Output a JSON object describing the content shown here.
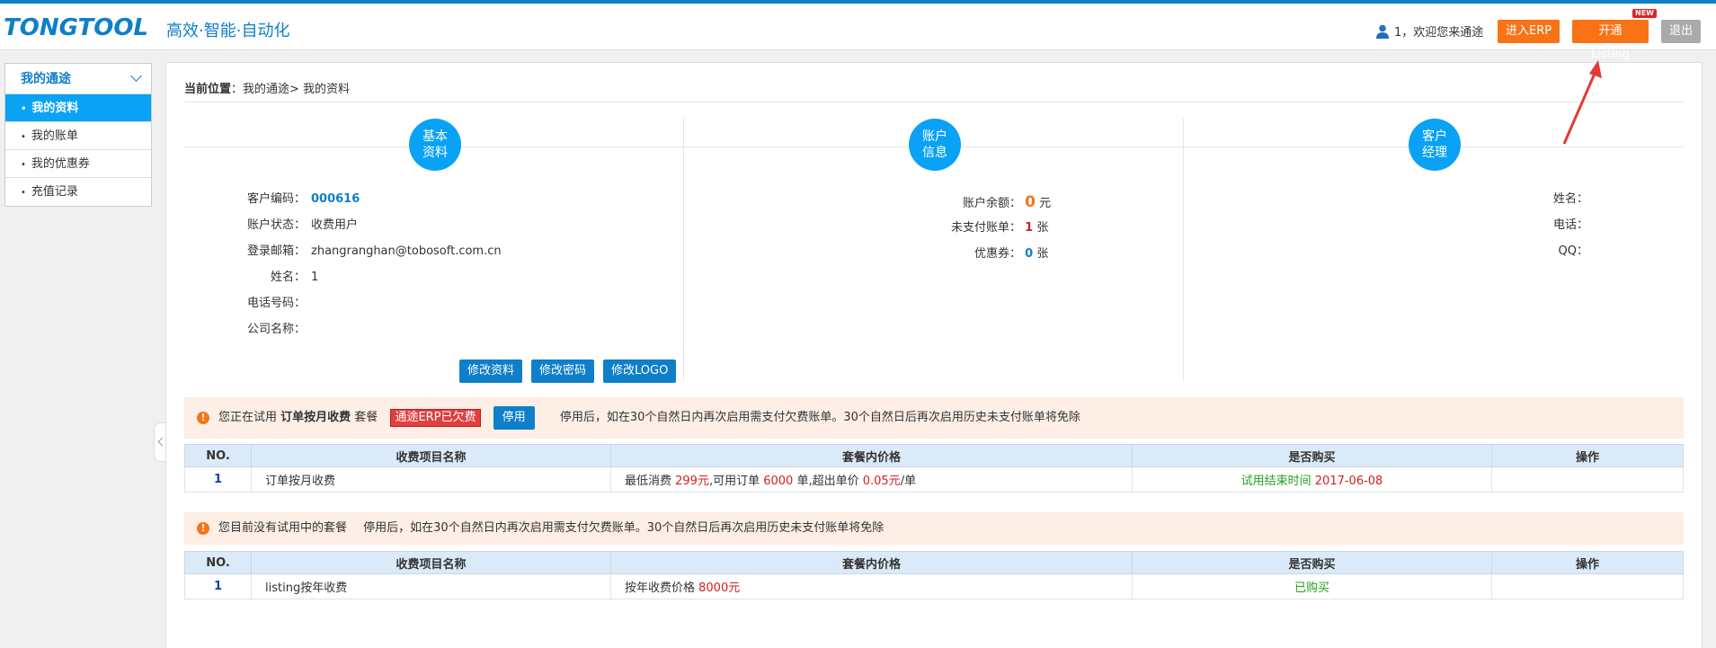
{
  "header": {
    "logo": "TONGTOOL",
    "slogan": "高效·智能·自动化",
    "welcome": "1，欢迎您来通途",
    "erp_button": "进入ERP",
    "listing_button": "开通Listing",
    "new_badge": "NEW",
    "logout_button": "退出"
  },
  "sidebar": {
    "title": "我的通途",
    "items": [
      {
        "label": "我的资料"
      },
      {
        "label": "我的账单"
      },
      {
        "label": "我的优惠券"
      },
      {
        "label": "充值记录"
      }
    ]
  },
  "breadcrumb": {
    "label": "当前位置",
    "path": "：我的通途> 我的资料"
  },
  "basic": {
    "title_line1": "基本",
    "title_line2": "资料",
    "rows": [
      {
        "label": "客户编码：",
        "value": "000616"
      },
      {
        "label": "账户状态：",
        "value": "收费用户"
      },
      {
        "label": "登录邮箱：",
        "value": "zhangranghan@tobosoft.com.cn"
      },
      {
        "label": "姓名：",
        "value": "1"
      },
      {
        "label": "电话号码：",
        "value": ""
      },
      {
        "label": "公司名称：",
        "value": ""
      }
    ],
    "buttons": [
      "修改资料",
      "修改密码",
      "修改LOGO"
    ]
  },
  "account": {
    "title_line1": "账户",
    "title_line2": "信息",
    "balance_label": "账户余额：",
    "balance_value": "0",
    "balance_unit": "元",
    "unpaid_label": "未支付账单：",
    "unpaid_value": "1",
    "unpaid_unit": "张",
    "coupon_label": "优惠券：",
    "coupon_value": "0",
    "coupon_unit": "张"
  },
  "manager": {
    "title_line1": "客户",
    "title_line2": "经理",
    "name_label": "姓名：",
    "phone_label": "电话：",
    "qq_label": "QQ："
  },
  "notice1": {
    "text_a": "您正在试用 ",
    "plan": "订单按月收费",
    "text_b": " 套餐",
    "tag": "通途ERP已欠费",
    "stop_button": "停用",
    "info": "停用后，如在30个自然日内再次启用需支付欠费账单。30个自然日后再次启用历史未支付账单将免除"
  },
  "notice2": {
    "text": "您目前没有试用中的套餐",
    "info": "停用后，如在30个自然日内再次启用需支付欠费账单。30个自然日后再次启用历史未支付账单将免除"
  },
  "table_headers": [
    "NO.",
    "收费项目名称",
    "套餐内价格",
    "是否购买",
    "操作"
  ],
  "table1": {
    "no": "1",
    "name": "订单按月收费",
    "price_a": "最低消费 ",
    "price_min": "299元",
    "price_b": ",可用订单 ",
    "price_orders": "6000",
    "price_c": " 单,超出单价 ",
    "price_unit": "0.05元",
    "price_d": "/单",
    "status_a": "试用结束时间 ",
    "status_date": "2017-06-08"
  },
  "table2": {
    "no": "1",
    "name": "listing按年收费",
    "price_a": "按年收费价格 ",
    "price_value": "8000元",
    "status": "已购买"
  },
  "colors": {
    "brand_blue": "#0f7fc9",
    "accent_orange": "#f97316",
    "notice_bg": "#fdeee6"
  }
}
